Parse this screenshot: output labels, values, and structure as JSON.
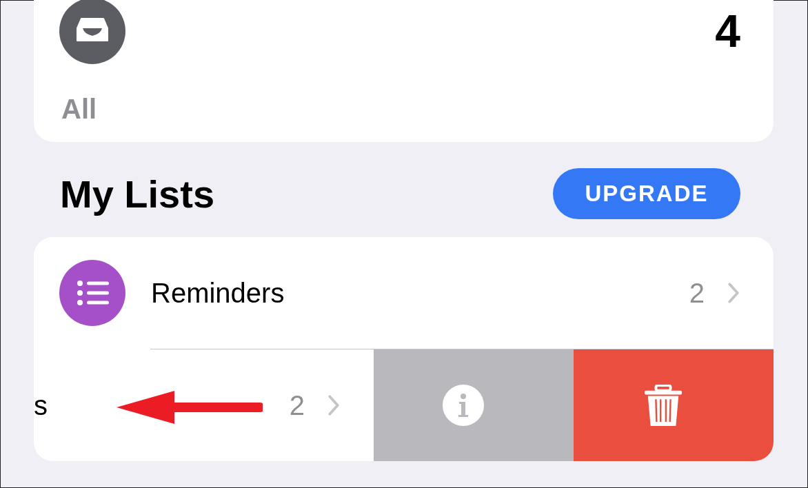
{
  "summary_card": {
    "count": "4",
    "label": "All"
  },
  "section": {
    "title": "My Lists",
    "button": "UPGRADE"
  },
  "lists": [
    {
      "name": "Reminders",
      "count": "2",
      "swiped": false
    },
    {
      "name": "s",
      "count": "2",
      "swiped": true
    }
  ],
  "swipe_actions": [
    {
      "kind": "info"
    },
    {
      "kind": "delete"
    }
  ]
}
